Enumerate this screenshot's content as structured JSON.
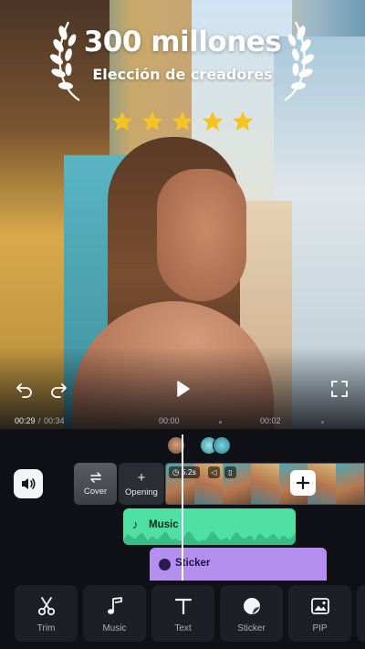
{
  "hero": {
    "title": "300 millones",
    "subtitle": "Elección de creadores",
    "rating_stars": 5
  },
  "player": {
    "current_time": "00:29",
    "separator": "/",
    "duration": "00:34",
    "timeline_marks": [
      "00:00",
      "00:02"
    ],
    "icons": {
      "undo": "undo-icon",
      "redo": "redo-icon",
      "play": "play-icon",
      "fullscreen": "fullscreen-icon"
    }
  },
  "timeline": {
    "mute_icon": "speaker-icon",
    "cover_label": "Cover",
    "opening_label": "Opening",
    "opening_glyph": "+",
    "clip_duration": "5.2s",
    "music_track_label": "Music",
    "sticker_track_label": "Sticker",
    "colors": {
      "music_track": "#4fe0a4",
      "sticker_track": "#b48ff0"
    }
  },
  "toolbar": {
    "items": [
      {
        "label": "Trim",
        "icon": "scissors-icon"
      },
      {
        "label": "Music",
        "icon": "music-note-icon"
      },
      {
        "label": "Text",
        "icon": "text-icon"
      },
      {
        "label": "Sticker",
        "icon": "sticker-icon"
      },
      {
        "label": "PIP",
        "icon": "picture-in-picture-icon"
      }
    ]
  },
  "colors": {
    "background": "#0f1116",
    "star": "#f6c324"
  }
}
